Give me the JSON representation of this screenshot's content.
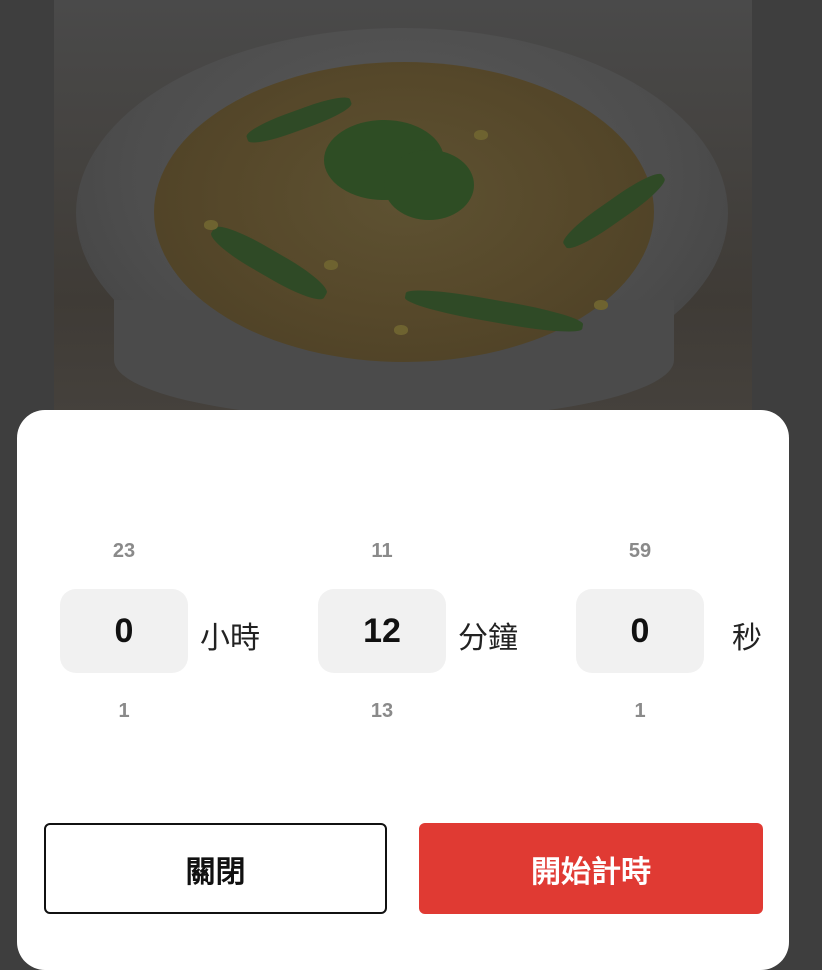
{
  "background_image": {
    "description_icon": "soup-photo"
  },
  "picker": {
    "hours": {
      "above": "23",
      "value": "0",
      "below": "1",
      "unit": "小時"
    },
    "minutes": {
      "above": "11",
      "value": "12",
      "below": "13",
      "unit": "分鐘"
    },
    "seconds": {
      "above": "59",
      "value": "0",
      "below": "1",
      "unit": "秒"
    }
  },
  "buttons": {
    "close_label": "關閉",
    "start_label": "開始計時"
  },
  "colors": {
    "accent": "#e03a33",
    "selection_bg": "#f1f1f1"
  }
}
